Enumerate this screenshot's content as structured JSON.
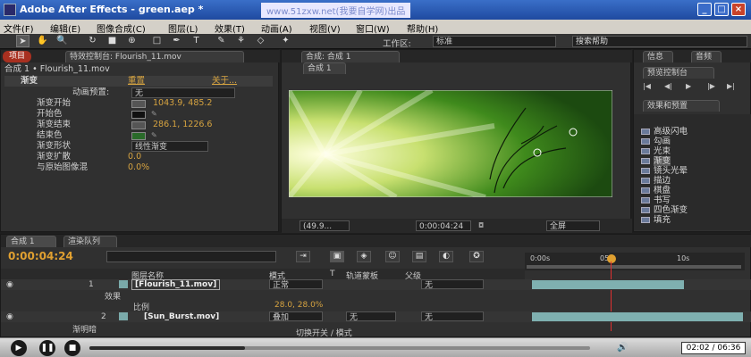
{
  "window": {
    "title": "Adobe After Effects - green.aep *",
    "watermark": "www.51zxw.net(我要自学网)出品",
    "min": "_",
    "max": "□",
    "close": "×"
  },
  "menu": [
    "文件(F)",
    "编辑(E)",
    "图像合成(C)",
    "图层(L)",
    "效果(T)",
    "动画(A)",
    "视图(V)",
    "窗口(W)",
    "帮助(H)"
  ],
  "toolbar": {
    "workspace_label": "工作区:",
    "workspace_value": "标准",
    "search_placeholder": "搜索帮助"
  },
  "effect_panel": {
    "project_tab": "项目",
    "tab": "特效控制台: Flourish_11.mov",
    "breadcrumb": "合成 1 • Flourish_11.mov",
    "effect_name": "渐变",
    "reset": "重置",
    "about": "关于...",
    "preset_label": "动画预置:",
    "preset_value": "无",
    "props": [
      {
        "label": "渐变开始",
        "value": "1043.9, 485.2"
      },
      {
        "label": "开始色",
        "value": ""
      },
      {
        "label": "渐变结束",
        "value": "286.1, 1226.6"
      },
      {
        "label": "结束色",
        "value": ""
      },
      {
        "label": "渐变形状",
        "value": "线性渐变"
      },
      {
        "label": "渐变扩散",
        "value": "0.0"
      },
      {
        "label": "与原始图像混",
        "value": "0.0%"
      }
    ],
    "colors": {
      "start": "#111111",
      "end": "#2a6a2a"
    }
  },
  "comp_panel": {
    "tab": "合成: 合成 1",
    "subtab": "合成 1",
    "zoom": "(49.9...",
    "timecode": "0:00:04:24",
    "view": "全屏"
  },
  "right_panels": {
    "info_tab": "信息",
    "audio_tab": "音频",
    "preview_tab": "预览控制台",
    "preview_buttons": [
      "|◀",
      "◀|",
      "▶",
      "|▶",
      "▶|"
    ],
    "effects_tab": "效果和预置",
    "items": [
      "高级闪电",
      "勾画",
      "光束",
      "渐变",
      "镜头光晕",
      "描边",
      "棋盘",
      "书写",
      "四色渐变",
      "填充"
    ]
  },
  "timeline": {
    "tab1": "合成 1",
    "tab2": "渲染队列",
    "timecode": "0:00:04:24",
    "search_placeholder": "",
    "col_headers": {
      "layer_name": "图层名称",
      "mode": "模式",
      "t": "T",
      "trkmat": "轨道蒙板",
      "parent": "父级"
    },
    "ruler": [
      "0:00s",
      "05s",
      "10s"
    ],
    "layers": [
      {
        "num": "1",
        "name": "[Flourish_11.mov]",
        "mode": "正常",
        "trkmat": "",
        "parent": "无"
      },
      {
        "num": "2",
        "name": "[Sun_Burst.mov]",
        "mode": "叠加",
        "trkmat": "无",
        "parent": "无"
      }
    ],
    "sub_effects": "效果",
    "sub_scale": "比例",
    "scale_value": "28.0, 28.0%",
    "cut_row": "渐明暗",
    "switch_modes": "切换开关 / 模式"
  },
  "player": {
    "time": "02:02 / 06:36",
    "progress": 0.31
  }
}
